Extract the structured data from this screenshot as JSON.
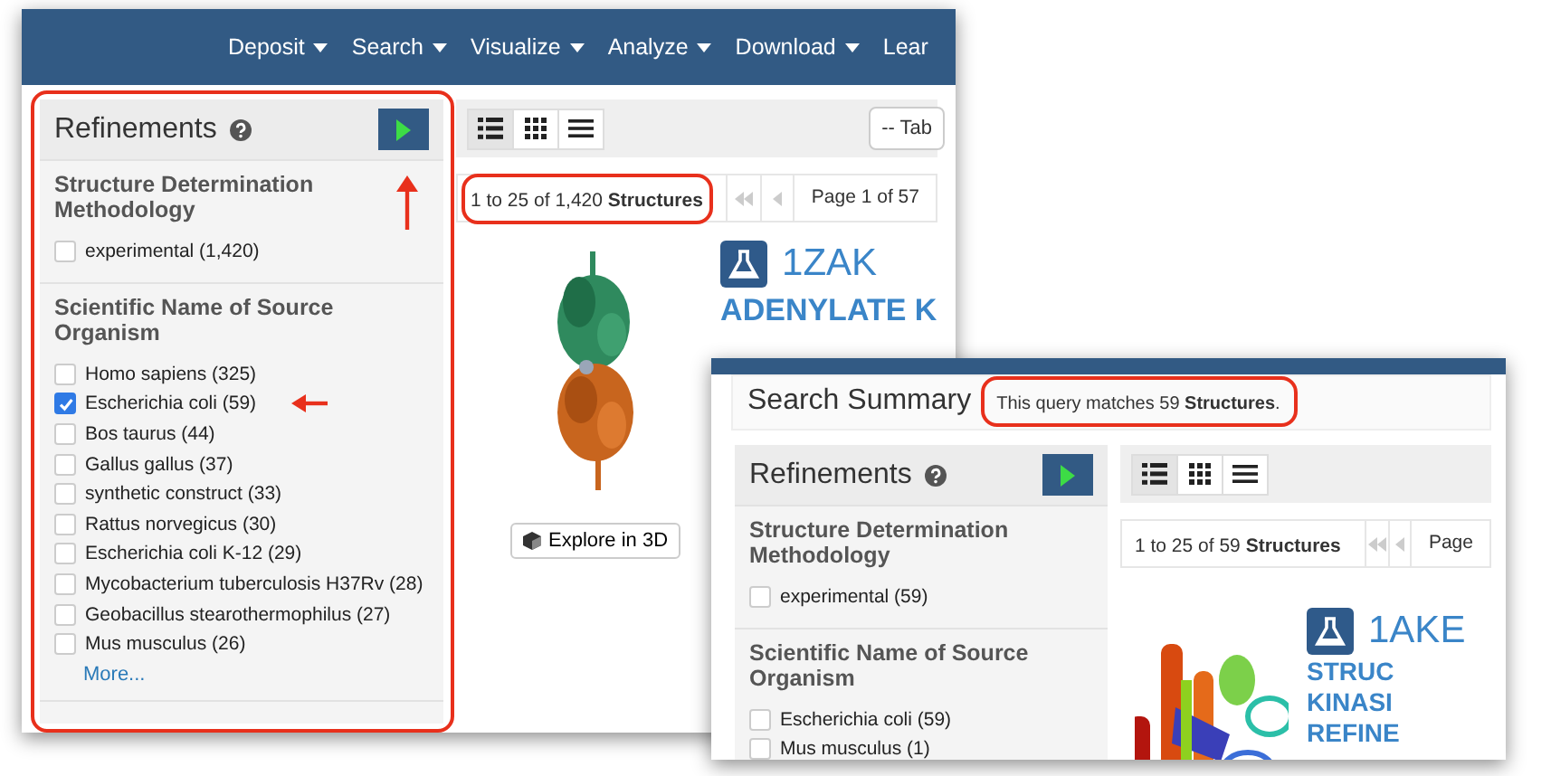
{
  "screens": [
    {
      "nav": [
        {
          "label": "Deposit"
        },
        {
          "label": "Search"
        },
        {
          "label": "Visualize"
        },
        {
          "label": "Analyze"
        },
        {
          "label": "Download"
        },
        {
          "label": "Lear"
        }
      ],
      "refinements": {
        "title": "Refinements",
        "highlighted": true,
        "apply_pointed": true,
        "groups": [
          {
            "title": "Structure Determination Methodology",
            "options": [
              {
                "label": "experimental (1,420)",
                "checked": false,
                "pointed": false
              }
            ]
          },
          {
            "title": "Scientific Name of Source Organism",
            "options": [
              {
                "label": "Homo sapiens (325)",
                "checked": false,
                "pointed": false
              },
              {
                "label": "Escherichia coli (59)",
                "checked": true,
                "pointed": true
              },
              {
                "label": "Bos taurus (44)",
                "checked": false,
                "pointed": false
              },
              {
                "label": "Gallus gallus (37)",
                "checked": false,
                "pointed": false
              },
              {
                "label": "synthetic construct (33)",
                "checked": false,
                "pointed": false
              },
              {
                "label": "Rattus norvegicus (30)",
                "checked": false,
                "pointed": false
              },
              {
                "label": "Escherichia coli K-12 (29)",
                "checked": false,
                "pointed": false
              },
              {
                "label": "Mycobacterium tuberculosis H37Rv (28)",
                "checked": false,
                "pointed": false
              },
              {
                "label": "Geobacillus stearothermophilus (27)",
                "checked": false,
                "pointed": false
              },
              {
                "label": "Mus musculus (26)",
                "checked": false,
                "pointed": false
              }
            ],
            "more": "More..."
          }
        ]
      },
      "view_modes": [
        {
          "kind": "list",
          "selected": true
        },
        {
          "kind": "grid",
          "selected": false
        },
        {
          "kind": "lines",
          "selected": false
        }
      ],
      "table_select": "-- Tab",
      "pagination": {
        "range": "1 to 25 of 1,420 **Structures**",
        "highlighted": true,
        "page": "Page 1 of 57"
      },
      "entry": {
        "id": "1ZAK",
        "title_lines": [
          "ADENYLATE K"
        ],
        "explore": "Explore in 3D",
        "picture": {
          "kind": "picture"
        }
      }
    },
    {
      "summary": {
        "title": "Search Summary",
        "text": "This query matches 59 **Structures**.",
        "highlighted": true
      },
      "refinements": {
        "title": "Refinements",
        "highlighted": false,
        "apply_pointed": false,
        "groups": [
          {
            "title": "Structure Determination Methodology",
            "options": [
              {
                "label": "experimental (59)",
                "checked": false,
                "pointed": false
              }
            ]
          },
          {
            "title": "Scientific Name of Source Organism",
            "options": [
              {
                "label": "Escherichia coli (59)",
                "checked": false,
                "pointed": false
              },
              {
                "label": "Mus musculus (1)",
                "checked": false,
                "pointed": false
              }
            ]
          }
        ]
      },
      "view_modes": [
        {
          "kind": "list",
          "selected": true
        },
        {
          "kind": "grid",
          "selected": false
        },
        {
          "kind": "lines",
          "selected": false
        }
      ],
      "pagination": {
        "range": "1 to 25 of 59 **Structures**",
        "highlighted": false,
        "page": "Page"
      },
      "entry": {
        "id": "1AKE",
        "title_lines": [
          "STRUC",
          "KINASI",
          "REFINE"
        ],
        "picture": {
          "kind": "picture"
        }
      }
    }
  ]
}
